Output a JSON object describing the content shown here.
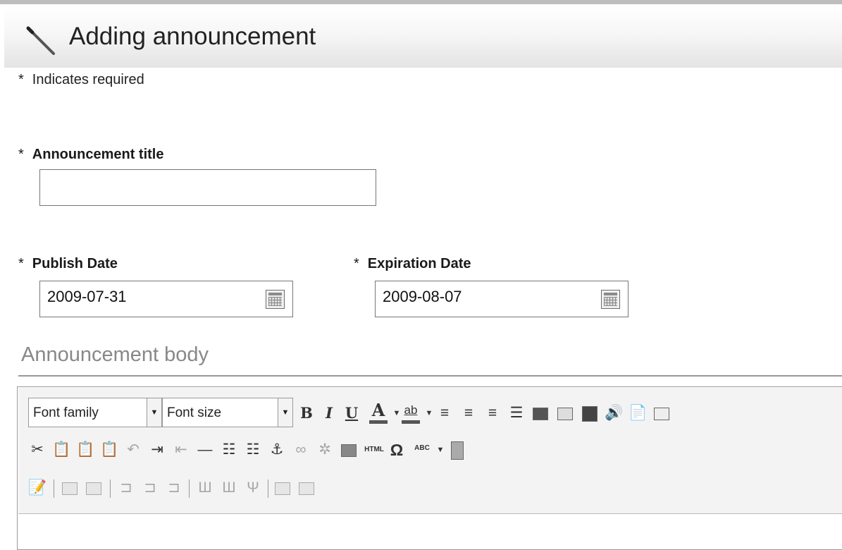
{
  "header": {
    "title": "Adding announcement",
    "icon": "pencil-icon"
  },
  "required_note": {
    "star": "*",
    "text": "Indicates required"
  },
  "fields": {
    "title": {
      "star": "*",
      "label": "Announcement title",
      "value": "",
      "placeholder": ""
    },
    "publish": {
      "star": "*",
      "label": "Publish Date",
      "value": "2009-07-31"
    },
    "expiration": {
      "star": "*",
      "label": "Expiration Date",
      "value": "2009-08-07"
    }
  },
  "body_section": {
    "label": "Announcement body"
  },
  "editor": {
    "font_family": "Font family",
    "font_size": "Font size",
    "text_tools": {
      "bold": "B",
      "italic": "I",
      "underline": "U",
      "text_color": "A",
      "highlight": "ab"
    },
    "row2_labels": {
      "html": "HTML",
      "special_char": "Ω",
      "spellcheck": "ABC"
    }
  },
  "colors": {
    "section_label": "#888888",
    "border": "#777777",
    "toolbar_bg": "#f3f3f3"
  }
}
